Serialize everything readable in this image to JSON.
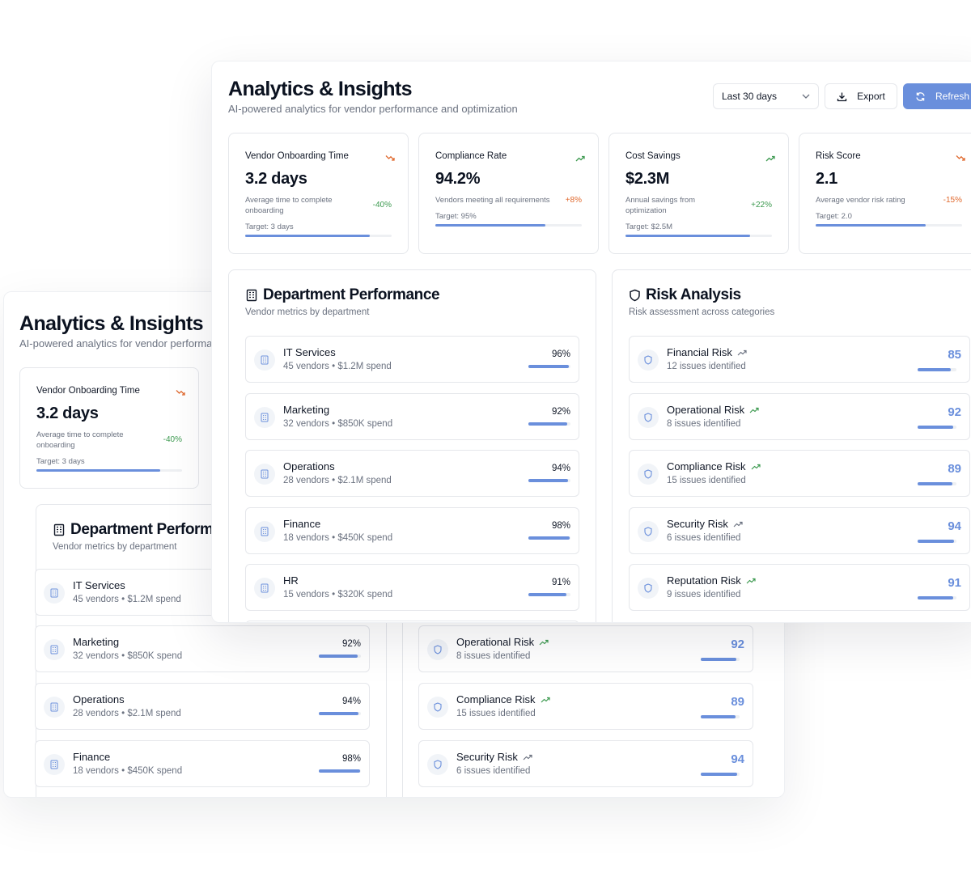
{
  "colors": {
    "accent": "#6a8fdc",
    "up": "#3d9a50",
    "down": "#e0692e",
    "muted": "#6b7280"
  },
  "header": {
    "title": "Analytics & Insights",
    "subtitle": "AI-powered analytics for vendor performance and optimization",
    "range_label": "Last 30 days",
    "export_label": "Export",
    "refresh_label": "Refresh"
  },
  "kpis": [
    {
      "title": "Vendor Onboarding Time",
      "trend": "down",
      "value": "3.2 days",
      "description": "Average time to complete onboarding",
      "change": "-40%",
      "change_color": "up",
      "target": "Target: 3 days",
      "progress": 0.85
    },
    {
      "title": "Compliance Rate",
      "trend": "up",
      "value": "94.2%",
      "description": "Vendors meeting all requirements",
      "change": "+8%",
      "change_color": "down",
      "target": "Target: 95%",
      "progress": 0.75
    },
    {
      "title": "Cost Savings",
      "trend": "up",
      "value": "$2.3M",
      "description": "Annual savings from optimization",
      "change": "+22%",
      "change_color": "up",
      "target": "Target: $2.5M",
      "progress": 0.85
    },
    {
      "title": "Risk Score",
      "trend": "down",
      "value": "2.1",
      "description": "Average vendor risk rating",
      "change": "-15%",
      "change_color": "down",
      "target": "Target: 2.0",
      "progress": 0.75
    }
  ],
  "departments": {
    "title": "Department Performance",
    "subtitle": "Vendor metrics by department",
    "items": [
      {
        "name": "IT Services",
        "meta": "45 vendors • $1.2M spend",
        "percent": "96%",
        "value": 0.96
      },
      {
        "name": "Marketing",
        "meta": "32 vendors • $850K spend",
        "percent": "92%",
        "value": 0.92
      },
      {
        "name": "Operations",
        "meta": "28 vendors • $2.1M spend",
        "percent": "94%",
        "value": 0.94
      },
      {
        "name": "Finance",
        "meta": "18 vendors • $450K spend",
        "percent": "98%",
        "value": 0.98
      },
      {
        "name": "HR",
        "meta": "15 vendors • $320K spend",
        "percent": "91%",
        "value": 0.91
      }
    ]
  },
  "risks": {
    "title": "Risk Analysis",
    "subtitle": "Risk assessment across categories",
    "items": [
      {
        "name": "Financial Risk",
        "meta": "12 issues identified",
        "score": "85",
        "value": 0.85
      },
      {
        "name": "Operational Risk",
        "meta": "8 issues identified",
        "score": "92",
        "value": 0.92
      },
      {
        "name": "Compliance Risk",
        "meta": "15 issues identified",
        "score": "89",
        "value": 0.89
      },
      {
        "name": "Security Risk",
        "meta": "6 issues identified",
        "score": "94",
        "value": 0.94
      },
      {
        "name": "Reputation Risk",
        "meta": "9 issues identified",
        "score": "91",
        "value": 0.91
      }
    ]
  }
}
